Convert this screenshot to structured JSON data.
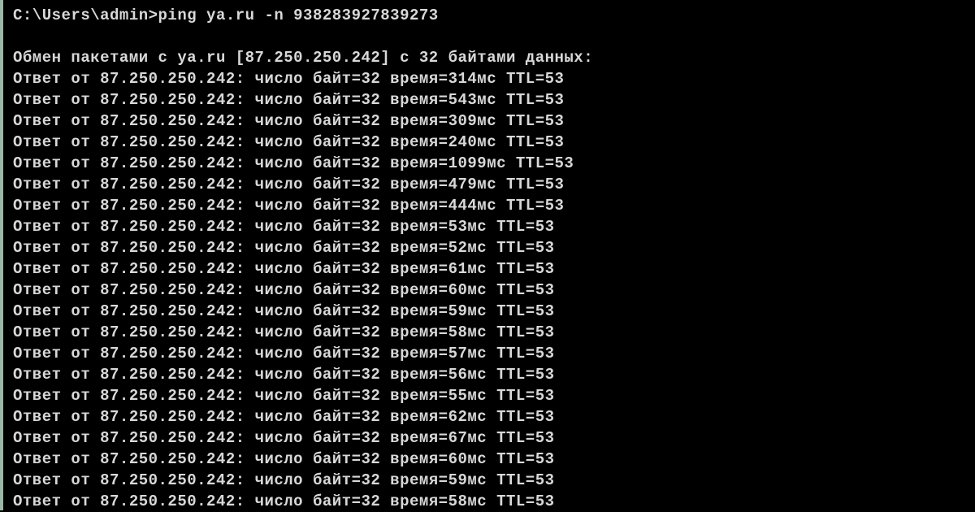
{
  "terminal": {
    "prompt": "C:\\Users\\admin>",
    "command": "ping ya.ru -n 938283927839273",
    "header": "Обмен пакетами с ya.ru [87.250.250.242] с 32 байтами данных:",
    "ip": "87.250.250.242",
    "bytes": 32,
    "ttl": 53,
    "reply_prefix": "Ответ от ",
    "bytes_label": "число байт=",
    "time_label": "время=",
    "time_unit": "мс",
    "ttl_label": "TTL=",
    "replies": [
      {
        "time": 314
      },
      {
        "time": 543
      },
      {
        "time": 309
      },
      {
        "time": 240
      },
      {
        "time": 1099
      },
      {
        "time": 479
      },
      {
        "time": 444
      },
      {
        "time": 53
      },
      {
        "time": 52
      },
      {
        "time": 61
      },
      {
        "time": 60
      },
      {
        "time": 59
      },
      {
        "time": 58
      },
      {
        "time": 57
      },
      {
        "time": 56
      },
      {
        "time": 55
      },
      {
        "time": 62
      },
      {
        "time": 67
      },
      {
        "time": 60
      },
      {
        "time": 59
      },
      {
        "time": 58
      }
    ]
  }
}
